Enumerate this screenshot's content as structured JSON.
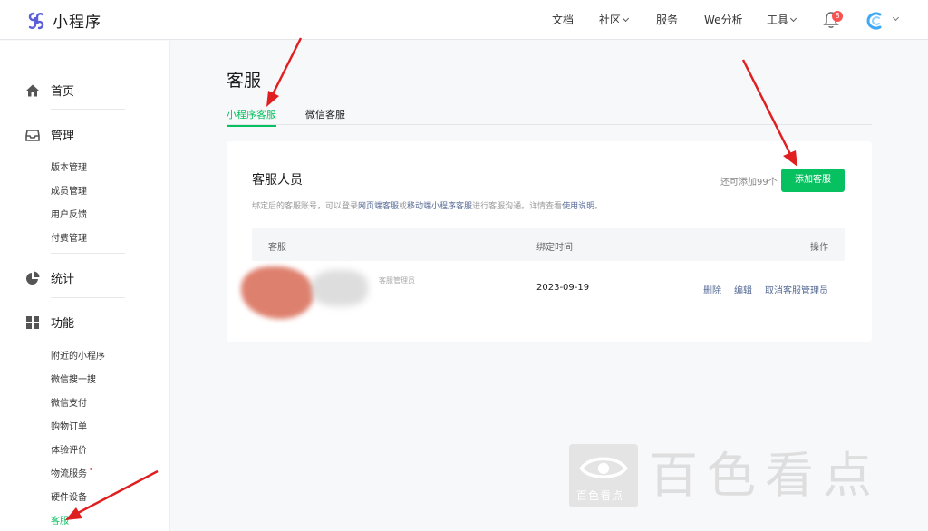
{
  "app": {
    "name": "小程序"
  },
  "topnav": {
    "docs": "文档",
    "community": "社区",
    "service": "服务",
    "analytics": "We分析",
    "tools": "工具",
    "notification_count": "8"
  },
  "sidebar": {
    "home": "首页",
    "manage": "管理",
    "manage_items": [
      "版本管理",
      "成员管理",
      "用户反馈",
      "付费管理"
    ],
    "stats": "统计",
    "features": "功能",
    "feature_items": [
      "附近的小程序",
      "微信搜一搜",
      "微信支付",
      "购物订单",
      "体验评价",
      "物流服务",
      "硬件设备",
      "客服"
    ]
  },
  "page": {
    "title": "客服",
    "tabs": [
      "小程序客服",
      "微信客服"
    ]
  },
  "card": {
    "title": "客服人员",
    "quota": "还可添加99个",
    "add_button": "添加客服",
    "desc_prefix": "绑定后的客服账号，可以登录",
    "desc_link1": "网页端客服",
    "desc_or": "或",
    "desc_link2": "移动端小程序客服",
    "desc_mid": "进行客服沟通。详情查看",
    "desc_link3": "使用说明",
    "desc_end": "。",
    "columns": {
      "agent": "客服",
      "bind_time": "绑定时间",
      "actions": "操作"
    },
    "rows": [
      {
        "agent_note": "客服管理员",
        "bind_time": "2023-09-19",
        "actions": [
          "删除",
          "编辑",
          "取消客服管理员"
        ]
      }
    ]
  },
  "watermark": {
    "small": "百色看点",
    "big": "百色看点"
  },
  "colors": {
    "accent": "#07c160",
    "link": "#576b95",
    "badge": "#fa5151",
    "annotation": "#e02020"
  }
}
